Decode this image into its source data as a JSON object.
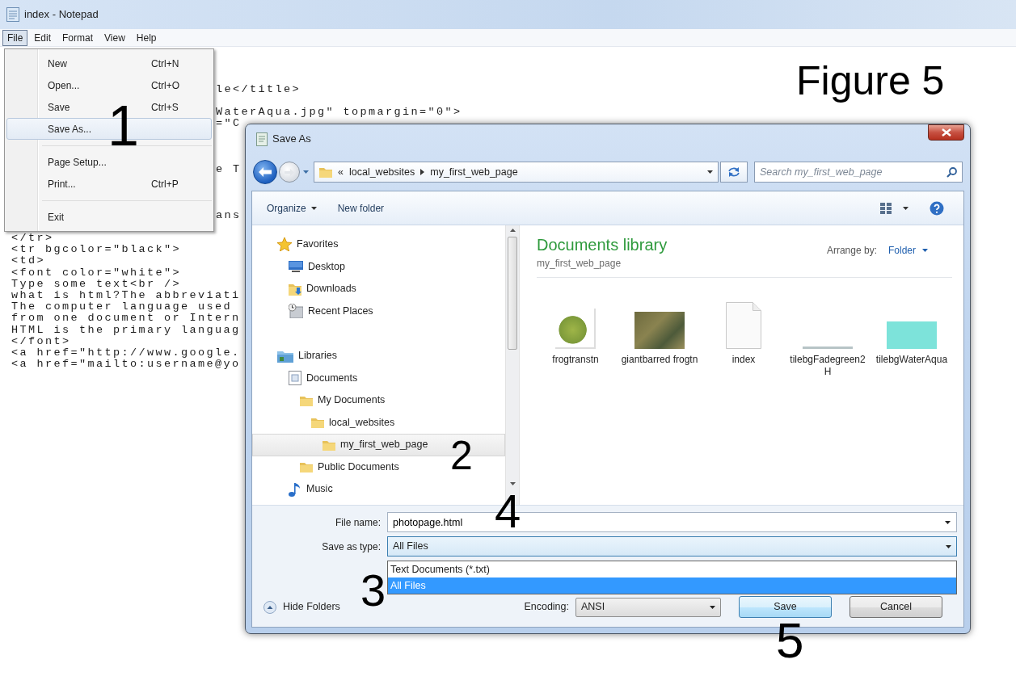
{
  "notepad": {
    "title": "index - Notepad",
    "menu": [
      {
        "label": "File",
        "selected": true
      },
      {
        "label": "Edit",
        "selected": false
      },
      {
        "label": "Format",
        "selected": false
      },
      {
        "label": "View",
        "selected": false
      },
      {
        "label": "Help",
        "selected": false
      }
    ],
    "lines": [
      {
        "kind": "covered"
      },
      {
        "kind": "covered"
      },
      {
        "kind": "covered"
      },
      {
        "kind": "tail",
        "text": "le</title>"
      },
      {
        "kind": "covered"
      },
      {
        "kind": "tail",
        "text": "WaterAqua.jpg\" topmargin=\"0\">"
      },
      {
        "kind": "tail",
        "text": "=\"C"
      },
      {
        "kind": "covered"
      },
      {
        "kind": "covered"
      },
      {
        "kind": "covered"
      },
      {
        "kind": "tail",
        "text": "e T"
      },
      {
        "kind": "covered"
      },
      {
        "kind": "covered"
      },
      {
        "kind": "covered"
      },
      {
        "kind": "tail",
        "text": "ans"
      },
      {
        "kind": "covered"
      },
      {
        "kind": "full",
        "text": "</tr>"
      },
      {
        "kind": "full",
        "text": "<tr bgcolor=\"black\">"
      },
      {
        "kind": "full",
        "text": "<td>"
      },
      {
        "kind": "full",
        "text": "<font color=\"white\">"
      },
      {
        "kind": "full",
        "text": "Type some text<br />"
      },
      {
        "kind": "full",
        "text": "what is html?The abbreviati"
      },
      {
        "kind": "full",
        "text": "The computer language used"
      },
      {
        "kind": "full",
        "text": "from one document or Intern"
      },
      {
        "kind": "full",
        "text": "HTML is the primary languag"
      },
      {
        "kind": "full",
        "text": "</font>"
      },
      {
        "kind": "full",
        "text": "<a href=\"http://www.google."
      },
      {
        "kind": "full",
        "text": "<a href=\"mailto:username@yo"
      }
    ]
  },
  "file_menu": [
    {
      "kind": "item",
      "label": "New",
      "shortcut": "Ctrl+N",
      "selected": false
    },
    {
      "kind": "item",
      "label": "Open...",
      "shortcut": "Ctrl+O",
      "selected": false
    },
    {
      "kind": "item",
      "label": "Save",
      "shortcut": "Ctrl+S",
      "selected": false
    },
    {
      "kind": "item",
      "label": "Save As...",
      "selected": true
    },
    {
      "kind": "separator"
    },
    {
      "kind": "item",
      "label": "Page Setup...",
      "selected": false
    },
    {
      "kind": "item",
      "label": "Print...",
      "shortcut": "Ctrl+P",
      "selected": false
    },
    {
      "kind": "separator"
    },
    {
      "kind": "item",
      "label": "Exit",
      "selected": false
    }
  ],
  "figure_label": "Figure 5",
  "annotations": [
    "1",
    "2",
    "4",
    "3",
    "5"
  ],
  "dialog": {
    "title": "Save As",
    "address": {
      "overflow": "«",
      "crumbs": [
        "local_websites",
        "my_first_web_page"
      ]
    },
    "search": {
      "placeholder": "Search my_first_web_page"
    },
    "toolbar": {
      "organize": "Organize",
      "new_folder": "New folder"
    },
    "tree": [
      {
        "label": "Favorites",
        "kind": "star",
        "selected": false,
        "children": [
          {
            "label": "Desktop",
            "kind": "desktop",
            "selected": false
          },
          {
            "label": "Downloads",
            "kind": "download",
            "selected": false
          },
          {
            "label": "Recent Places",
            "kind": "recent",
            "selected": false
          }
        ]
      },
      {
        "label": "Libraries",
        "kind": "library",
        "selected": false,
        "children": [
          {
            "label": "Documents",
            "kind": "documents",
            "selected": false,
            "children": [
              {
                "label": "My Documents",
                "kind": "folder",
                "selected": false,
                "children": [
                  {
                    "label": "local_websites",
                    "kind": "folder",
                    "selected": false,
                    "children": [
                      {
                        "label": "my_first_web_page",
                        "kind": "folder",
                        "selected": true
                      }
                    ]
                  }
                ]
              },
              {
                "label": "Public Documents",
                "kind": "folder",
                "selected": false
              }
            ]
          },
          {
            "label": "Music",
            "kind": "music",
            "selected": false
          }
        ]
      }
    ],
    "library": {
      "title": "Documents library",
      "subtitle": "my_first_web_page",
      "arrange_label": "Arrange by:",
      "arrange_value": "Folder"
    },
    "files": [
      {
        "name": "frogtranstn",
        "kind": "photo"
      },
      {
        "name": "giantbarred frogtn",
        "kind": "photo_wide"
      },
      {
        "name": "index",
        "kind": "document"
      },
      {
        "name": "tilebgFadegreen2H",
        "kind": "strip"
      },
      {
        "name": "tilebgWaterAqua",
        "kind": "tile"
      }
    ],
    "file_name": {
      "label": "File name:",
      "value": "photopage.html"
    },
    "save_type": {
      "label": "Save as type:",
      "value": "All Files",
      "expanded": true,
      "options": [
        {
          "label": "Text Documents (*.txt)",
          "selected": false
        },
        {
          "label": "All Files",
          "selected": true
        }
      ]
    },
    "hide_folders": "Hide Folders",
    "encoding": {
      "label": "Encoding:",
      "value": "ANSI"
    },
    "buttons": [
      {
        "label": "Save",
        "default": true
      },
      {
        "label": "Cancel",
        "default": false
      }
    ]
  }
}
